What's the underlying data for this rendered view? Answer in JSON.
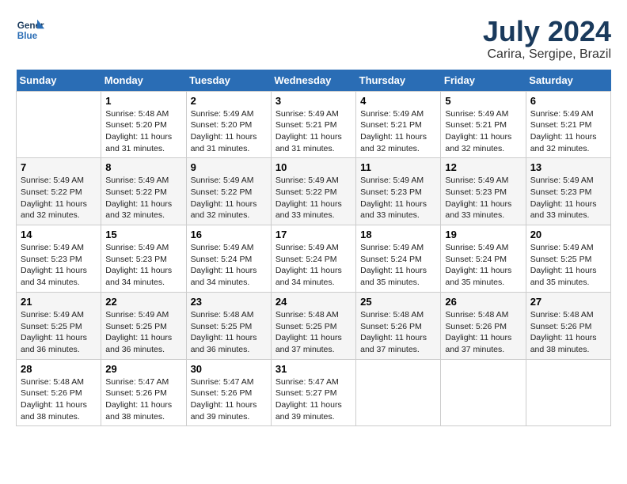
{
  "header": {
    "logo_line1": "General",
    "logo_line2": "Blue",
    "month": "July 2024",
    "location": "Carira, Sergipe, Brazil"
  },
  "weekdays": [
    "Sunday",
    "Monday",
    "Tuesday",
    "Wednesday",
    "Thursday",
    "Friday",
    "Saturday"
  ],
  "weeks": [
    [
      {
        "day": "",
        "info": ""
      },
      {
        "day": "1",
        "info": "Sunrise: 5:48 AM\nSunset: 5:20 PM\nDaylight: 11 hours\nand 31 minutes."
      },
      {
        "day": "2",
        "info": "Sunrise: 5:49 AM\nSunset: 5:20 PM\nDaylight: 11 hours\nand 31 minutes."
      },
      {
        "day": "3",
        "info": "Sunrise: 5:49 AM\nSunset: 5:21 PM\nDaylight: 11 hours\nand 31 minutes."
      },
      {
        "day": "4",
        "info": "Sunrise: 5:49 AM\nSunset: 5:21 PM\nDaylight: 11 hours\nand 32 minutes."
      },
      {
        "day": "5",
        "info": "Sunrise: 5:49 AM\nSunset: 5:21 PM\nDaylight: 11 hours\nand 32 minutes."
      },
      {
        "day": "6",
        "info": "Sunrise: 5:49 AM\nSunset: 5:21 PM\nDaylight: 11 hours\nand 32 minutes."
      }
    ],
    [
      {
        "day": "7",
        "info": "Sunrise: 5:49 AM\nSunset: 5:22 PM\nDaylight: 11 hours\nand 32 minutes."
      },
      {
        "day": "8",
        "info": "Sunrise: 5:49 AM\nSunset: 5:22 PM\nDaylight: 11 hours\nand 32 minutes."
      },
      {
        "day": "9",
        "info": "Sunrise: 5:49 AM\nSunset: 5:22 PM\nDaylight: 11 hours\nand 32 minutes."
      },
      {
        "day": "10",
        "info": "Sunrise: 5:49 AM\nSunset: 5:22 PM\nDaylight: 11 hours\nand 33 minutes."
      },
      {
        "day": "11",
        "info": "Sunrise: 5:49 AM\nSunset: 5:23 PM\nDaylight: 11 hours\nand 33 minutes."
      },
      {
        "day": "12",
        "info": "Sunrise: 5:49 AM\nSunset: 5:23 PM\nDaylight: 11 hours\nand 33 minutes."
      },
      {
        "day": "13",
        "info": "Sunrise: 5:49 AM\nSunset: 5:23 PM\nDaylight: 11 hours\nand 33 minutes."
      }
    ],
    [
      {
        "day": "14",
        "info": "Sunrise: 5:49 AM\nSunset: 5:23 PM\nDaylight: 11 hours\nand 34 minutes."
      },
      {
        "day": "15",
        "info": "Sunrise: 5:49 AM\nSunset: 5:23 PM\nDaylight: 11 hours\nand 34 minutes."
      },
      {
        "day": "16",
        "info": "Sunrise: 5:49 AM\nSunset: 5:24 PM\nDaylight: 11 hours\nand 34 minutes."
      },
      {
        "day": "17",
        "info": "Sunrise: 5:49 AM\nSunset: 5:24 PM\nDaylight: 11 hours\nand 34 minutes."
      },
      {
        "day": "18",
        "info": "Sunrise: 5:49 AM\nSunset: 5:24 PM\nDaylight: 11 hours\nand 35 minutes."
      },
      {
        "day": "19",
        "info": "Sunrise: 5:49 AM\nSunset: 5:24 PM\nDaylight: 11 hours\nand 35 minutes."
      },
      {
        "day": "20",
        "info": "Sunrise: 5:49 AM\nSunset: 5:25 PM\nDaylight: 11 hours\nand 35 minutes."
      }
    ],
    [
      {
        "day": "21",
        "info": "Sunrise: 5:49 AM\nSunset: 5:25 PM\nDaylight: 11 hours\nand 36 minutes."
      },
      {
        "day": "22",
        "info": "Sunrise: 5:49 AM\nSunset: 5:25 PM\nDaylight: 11 hours\nand 36 minutes."
      },
      {
        "day": "23",
        "info": "Sunrise: 5:48 AM\nSunset: 5:25 PM\nDaylight: 11 hours\nand 36 minutes."
      },
      {
        "day": "24",
        "info": "Sunrise: 5:48 AM\nSunset: 5:25 PM\nDaylight: 11 hours\nand 37 minutes."
      },
      {
        "day": "25",
        "info": "Sunrise: 5:48 AM\nSunset: 5:26 PM\nDaylight: 11 hours\nand 37 minutes."
      },
      {
        "day": "26",
        "info": "Sunrise: 5:48 AM\nSunset: 5:26 PM\nDaylight: 11 hours\nand 37 minutes."
      },
      {
        "day": "27",
        "info": "Sunrise: 5:48 AM\nSunset: 5:26 PM\nDaylight: 11 hours\nand 38 minutes."
      }
    ],
    [
      {
        "day": "28",
        "info": "Sunrise: 5:48 AM\nSunset: 5:26 PM\nDaylight: 11 hours\nand 38 minutes."
      },
      {
        "day": "29",
        "info": "Sunrise: 5:47 AM\nSunset: 5:26 PM\nDaylight: 11 hours\nand 38 minutes."
      },
      {
        "day": "30",
        "info": "Sunrise: 5:47 AM\nSunset: 5:26 PM\nDaylight: 11 hours\nand 39 minutes."
      },
      {
        "day": "31",
        "info": "Sunrise: 5:47 AM\nSunset: 5:27 PM\nDaylight: 11 hours\nand 39 minutes."
      },
      {
        "day": "",
        "info": ""
      },
      {
        "day": "",
        "info": ""
      },
      {
        "day": "",
        "info": ""
      }
    ]
  ]
}
